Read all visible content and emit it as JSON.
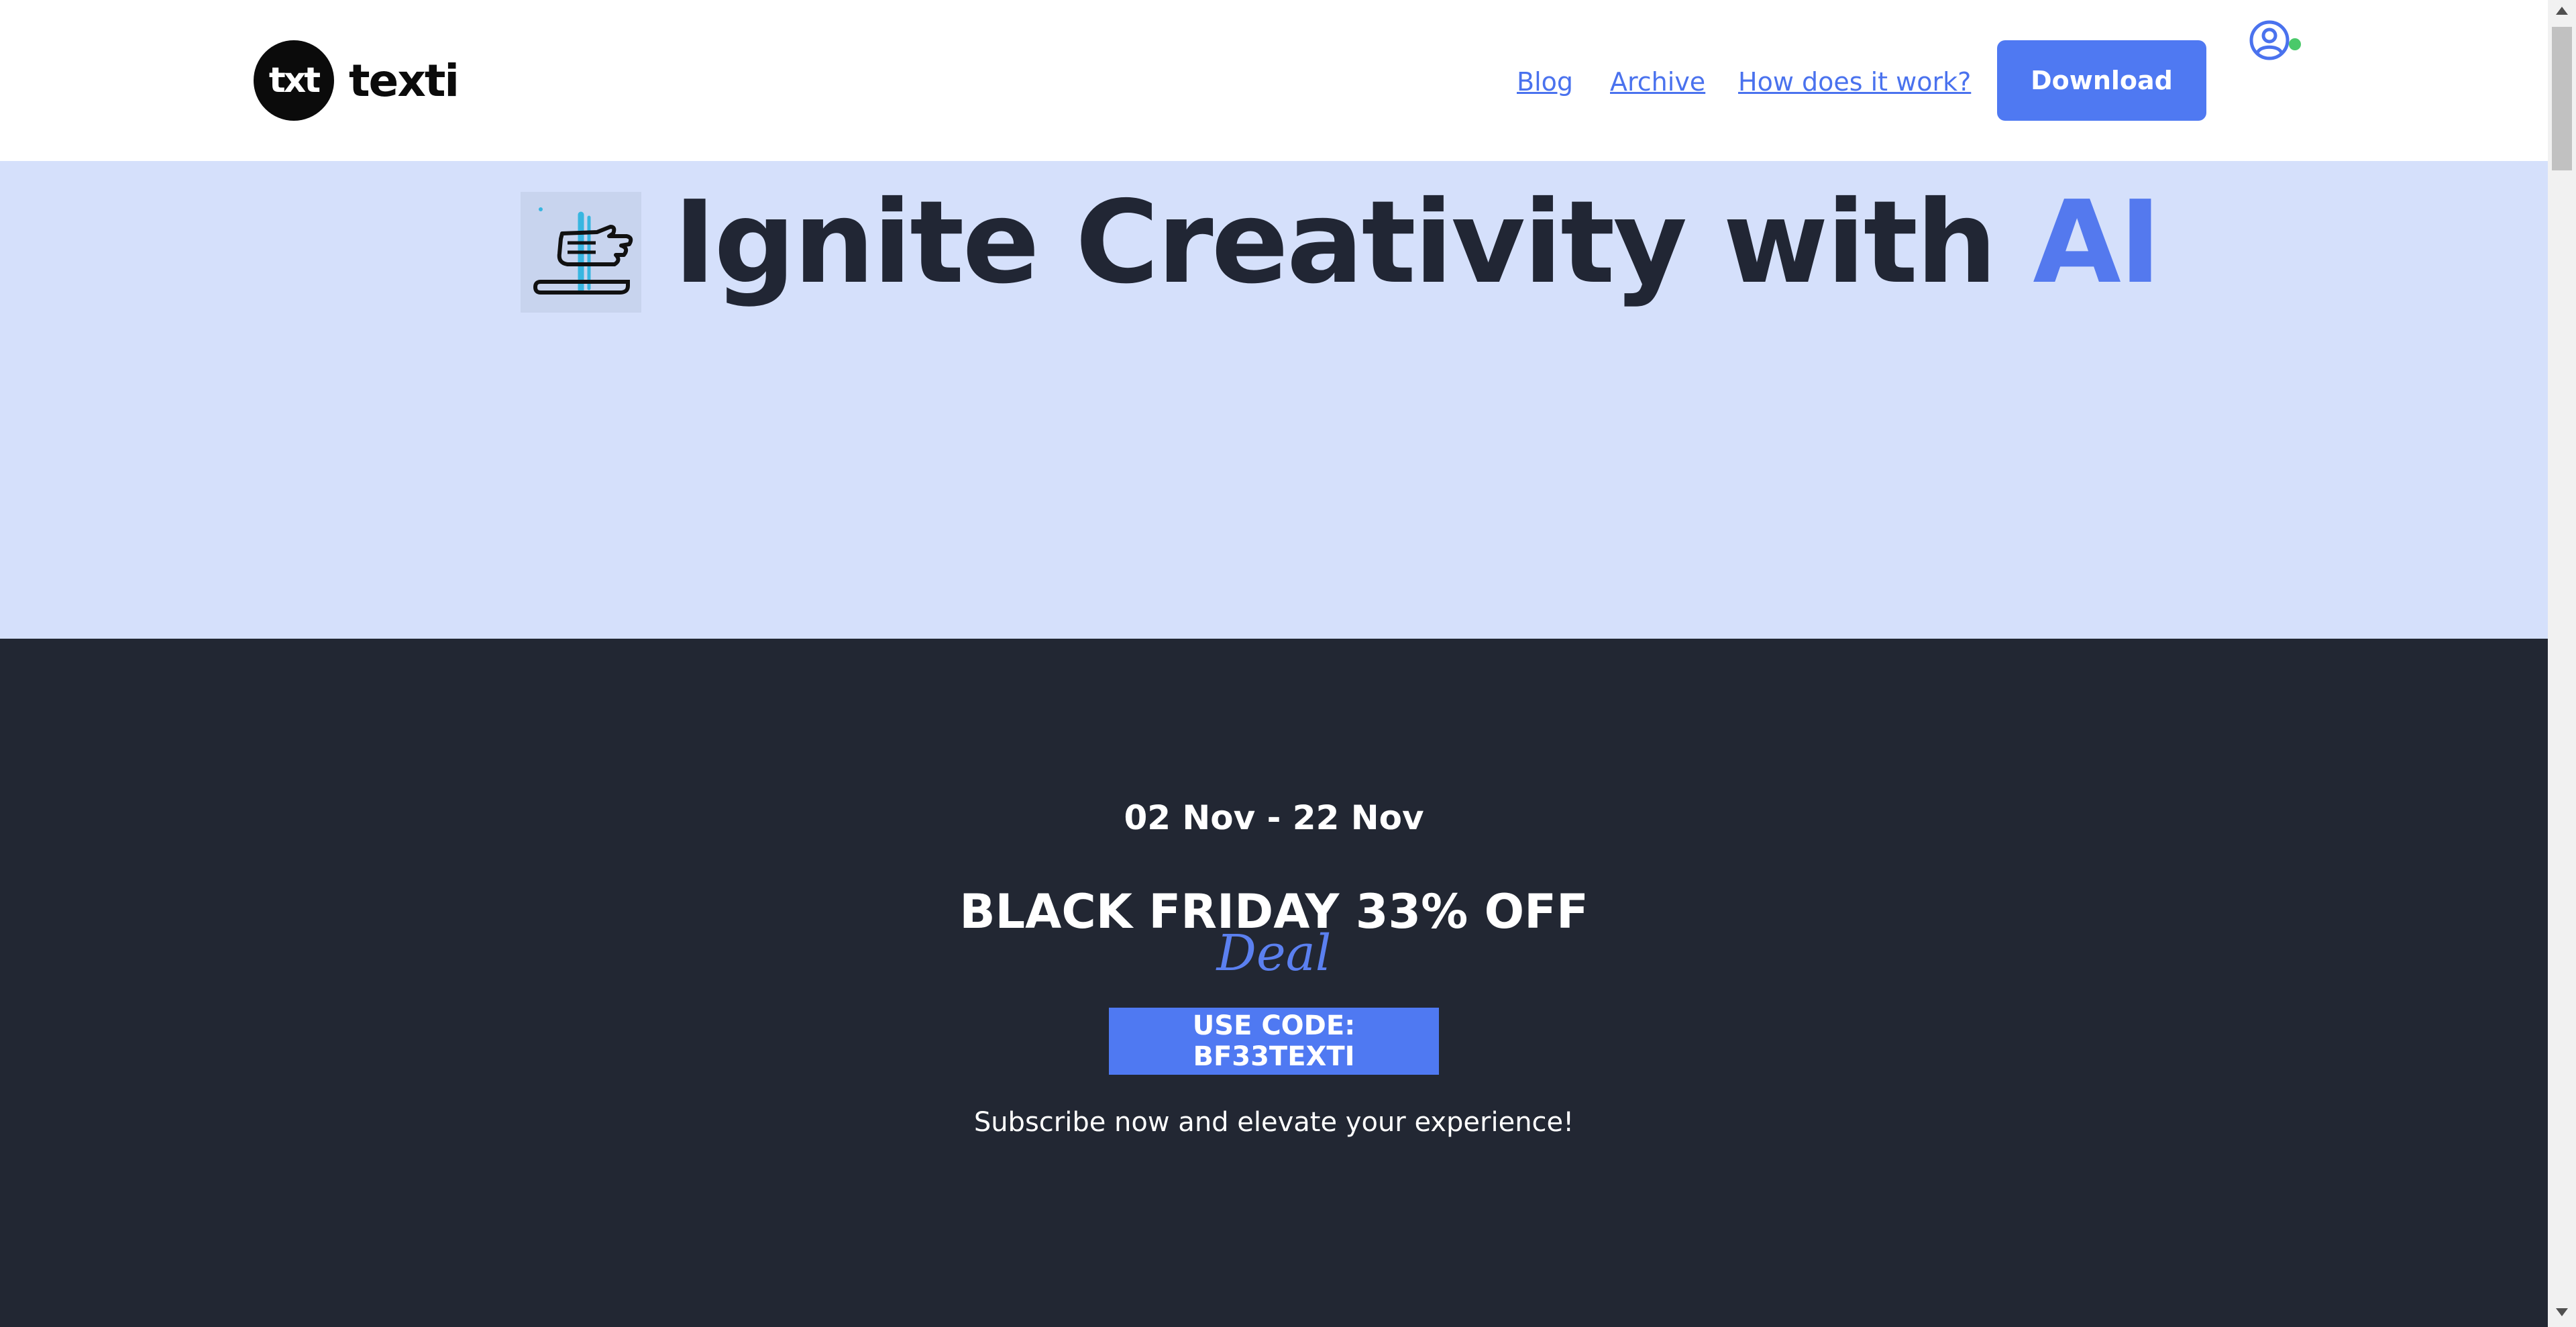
{
  "header": {
    "logo_mark": "txt",
    "logo_word": "texti",
    "nav": {
      "blog": "Blog",
      "archive": "Archive",
      "how": "How does it work?"
    },
    "download_label": "Download",
    "account_icon": "user-circle-icon",
    "status_color": "#4ac96a"
  },
  "hero": {
    "emoji_icon": "writing-hand-icon",
    "title_main": "Ignite Creativity with ",
    "title_accent": "AI",
    "background": "#d5e0fb",
    "accent_color": "#5479ee"
  },
  "promo": {
    "date_range": "02 Nov - 22 Nov",
    "headline": "BLACK FRIDAY 33% OFF",
    "deal": "Deal",
    "code_button": "USE CODE: BF33TEXTI",
    "subtitle": "Subscribe now and elevate your experience!",
    "background": "#222733"
  },
  "colors": {
    "brand": "#4f79f2"
  }
}
